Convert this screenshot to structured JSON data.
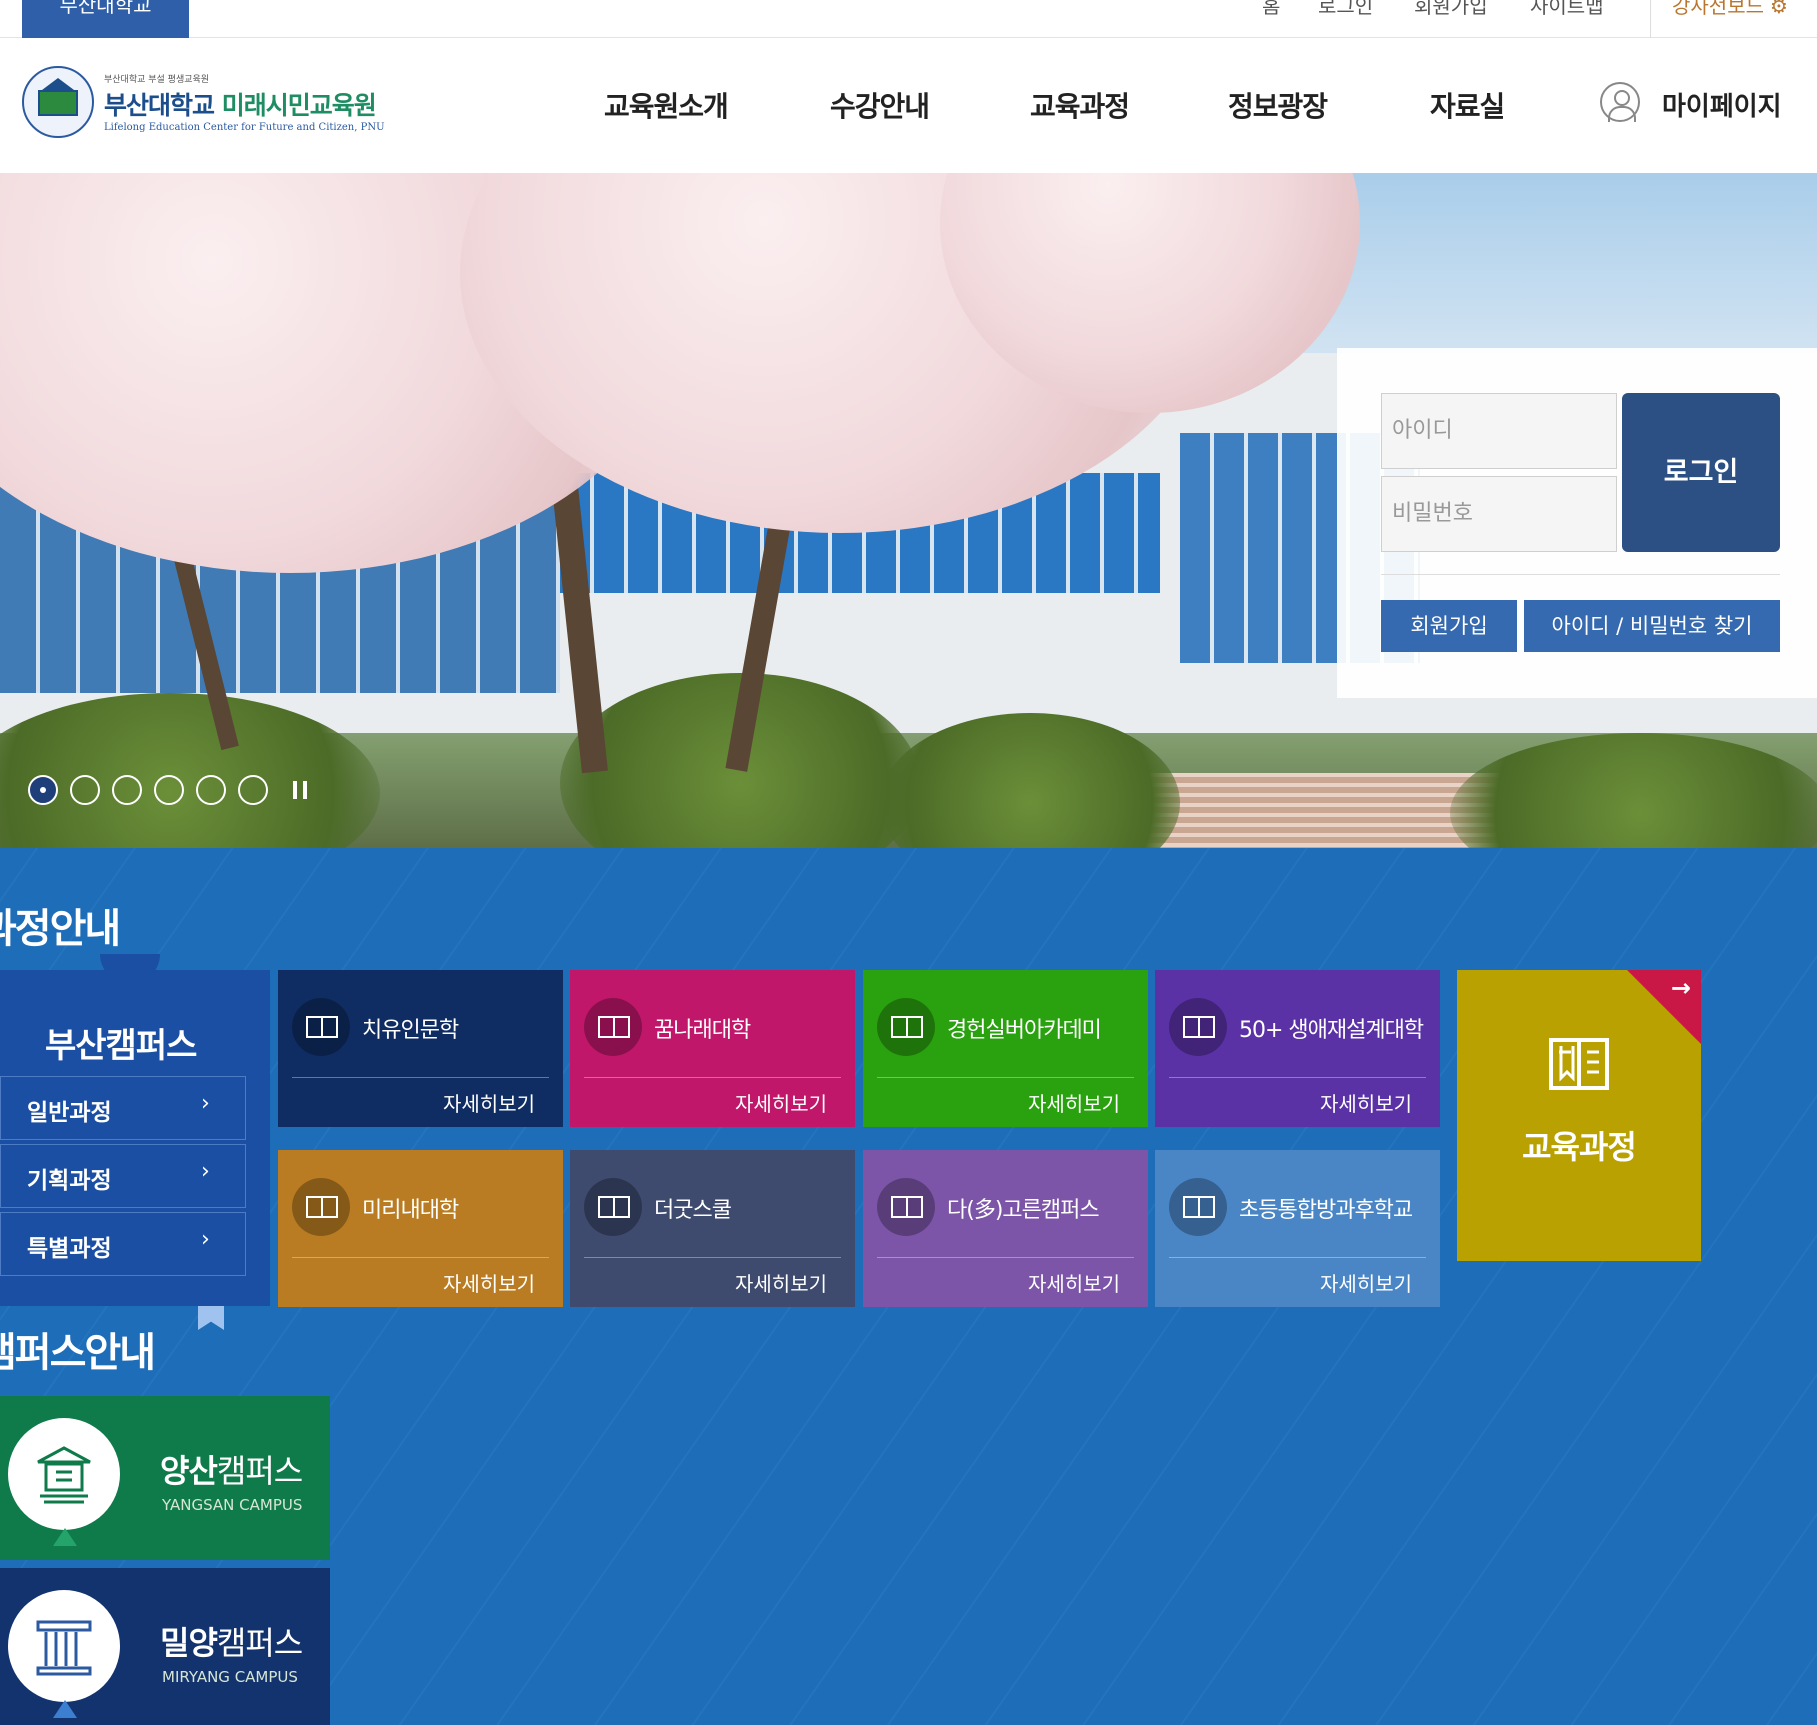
{
  "topbar": {
    "university_tab": "부산대학교",
    "links": [
      "홈",
      "로그인",
      "회원가입",
      "사이트맵"
    ],
    "instructor_board": "강사전보드"
  },
  "header": {
    "logo_small": "부산대학교 부설 평생교육원",
    "logo_main_a": "부산대학교",
    "logo_main_b": "미래시민교육원",
    "logo_eng": "Lifelong Education Center for Future and Citizen, PNU",
    "nav": [
      "교육원소개",
      "수강안내",
      "교육과정",
      "정보광장",
      "자료실"
    ],
    "mypage": "마이페이지"
  },
  "hero": {
    "slide_count": 6,
    "active_slide": 1
  },
  "login": {
    "id_placeholder": "아이디",
    "pw_placeholder": "비밀번호",
    "login_button": "로그인",
    "join_button": "회원가입",
    "find_button": "아이디 / 비밀번호 찾기"
  },
  "courses": {
    "section_title": "과정안내",
    "campus_name": "부산캠퍼스",
    "menu": [
      "일반과정",
      "기획과정",
      "특별과정"
    ],
    "chevron": "›",
    "cards": [
      {
        "name": "치유인문학",
        "more": "자세히보기",
        "color": "#0f2d63"
      },
      {
        "name": "꿈나래대학",
        "more": "자세히보기",
        "color": "#c0176b"
      },
      {
        "name": "경헌실버아카데미",
        "more": "자세히보기",
        "color": "#2aa10f"
      },
      {
        "name": "50+ 생애재설계대학",
        "more": "자세히보기",
        "color": "#5a32a6"
      },
      {
        "name": "미리내대학",
        "more": "자세히보기",
        "color": "#b97c22"
      },
      {
        "name": "더굿스쿨",
        "more": "자세히보기",
        "color": "#3e4a6e"
      },
      {
        "name": "다(多)고른캠퍼스",
        "more": "자세히보기",
        "color": "#7c55a8"
      },
      {
        "name": "초등통합방과후학교",
        "more": "자세히보기",
        "color": "#4a86c6"
      }
    ],
    "edu_box_label": "교육과정",
    "edu_box_arrow": "→"
  },
  "campuses": {
    "section_title": "캠퍼스안내",
    "items": [
      {
        "name_bold": "양산",
        "name_rest": "캠퍼스",
        "eng": "YANGSAN CAMPUS",
        "color": "#0f7a4a",
        "icon": "graduation-building-icon"
      },
      {
        "name_bold": "밀양",
        "name_rest": "캠퍼스",
        "eng": "MIRYANG CAMPUS",
        "color": "#13336e",
        "icon": "pillar-icon"
      }
    ]
  },
  "colors": {
    "brand_blue": "#2e5fa8",
    "section_blue": "#1d6db8",
    "login_button": "#2c4f84",
    "edu_box": "#b8a100",
    "edu_corner": "#c91746"
  }
}
